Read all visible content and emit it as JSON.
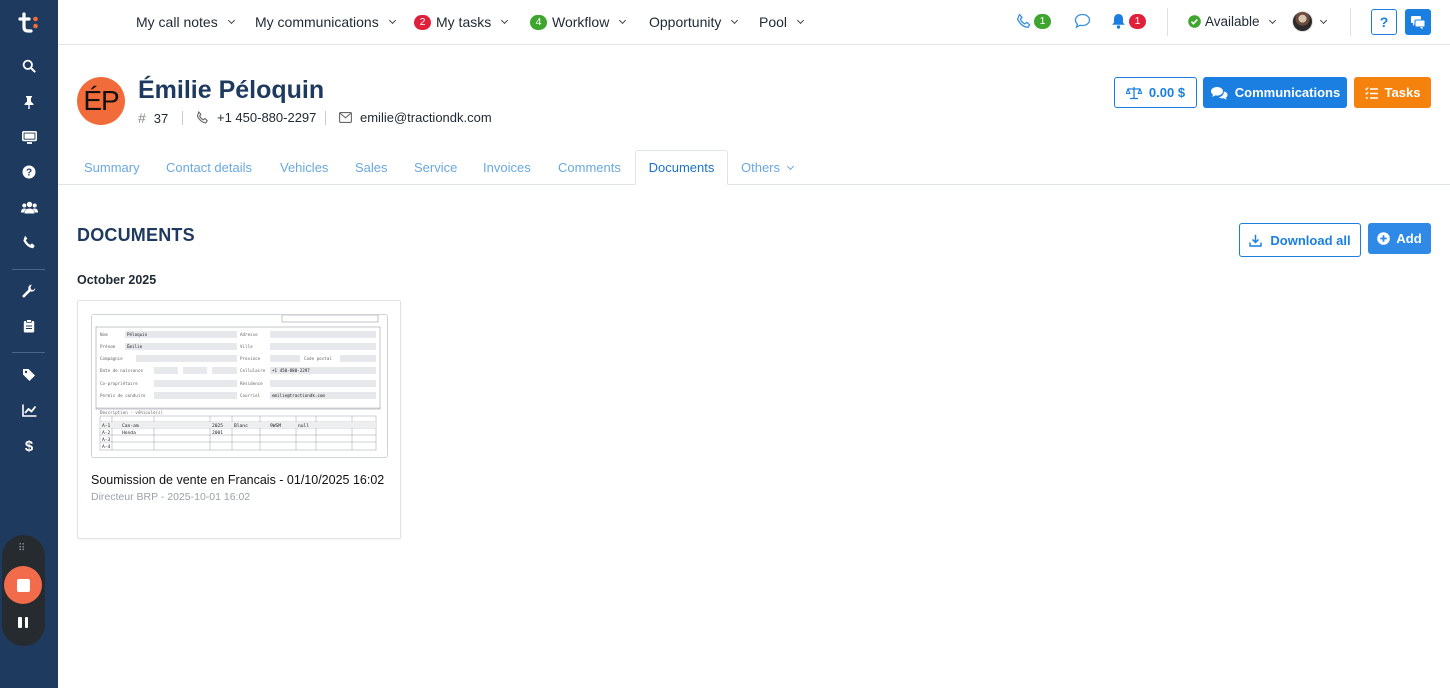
{
  "colors": {
    "sidebar": "#1e3a5f",
    "accent_blue": "#1a7fe0",
    "accent_orange": "#f5820d",
    "badge_red": "#e0203a",
    "badge_green": "#3ea52e",
    "avatar_bg": "#f26b3a"
  },
  "sidebar": {
    "logo": "traction-logo",
    "items": [
      {
        "icon": "search-icon"
      },
      {
        "icon": "pin-icon"
      },
      {
        "icon": "monitor-icon"
      },
      {
        "icon": "help-circle-icon"
      },
      {
        "icon": "users-icon"
      },
      {
        "icon": "phone-icon"
      },
      {
        "icon": "wrench-icon"
      },
      {
        "icon": "clipboard-icon"
      },
      {
        "icon": "tag-icon"
      },
      {
        "icon": "chart-line-icon"
      },
      {
        "icon": "dollar-icon"
      }
    ]
  },
  "topnav": {
    "items": [
      {
        "label": "My call notes"
      },
      {
        "label": "My communications"
      },
      {
        "label": "My tasks",
        "badge": "2"
      },
      {
        "label": "Workflow",
        "badge": "4"
      },
      {
        "label": "Opportunity"
      },
      {
        "label": "Pool"
      }
    ],
    "phone_badge": "1",
    "notification_badge": "1",
    "status": "Available",
    "help": "?"
  },
  "contact": {
    "initials": "ÉP",
    "name": "Émilie Péloquin",
    "id": "37",
    "phone": "+1 450-880-2297",
    "email": "emilie@tractiondk.com"
  },
  "header_buttons": {
    "balance": "0.00 $",
    "communications": "Communications",
    "tasks": "Tasks"
  },
  "tabs": {
    "items": [
      "Summary",
      "Contact details",
      "Vehicles",
      "Sales",
      "Service",
      "Invoices",
      "Comments",
      "Documents",
      "Others"
    ],
    "active": "Documents"
  },
  "documents": {
    "title": "DOCUMENTS",
    "download_all": "Download all",
    "add": "Add",
    "groups": [
      {
        "label": "October 2025",
        "items": [
          {
            "title": "Soumission de vente en Francais - 01/10/2025 16:02",
            "subtitle": "Directeur BRP - 2025-10-01 16:02"
          }
        ]
      }
    ]
  },
  "recorder": {
    "controls": [
      "stop",
      "pause"
    ]
  }
}
